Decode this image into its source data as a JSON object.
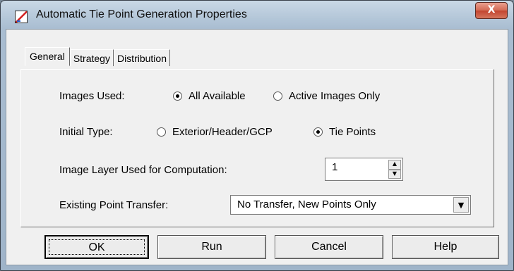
{
  "window": {
    "title": "Automatic Tie Point Generation Properties",
    "close_label": "X"
  },
  "tabs": [
    {
      "label": "General",
      "active": true
    },
    {
      "label": "Strategy",
      "active": false
    },
    {
      "label": "Distribution",
      "active": false
    }
  ],
  "general": {
    "images_used": {
      "label": "Images Used:",
      "options": [
        {
          "label": "All Available",
          "selected": true
        },
        {
          "label": "Active Images Only",
          "selected": false
        }
      ]
    },
    "initial_type": {
      "label": "Initial Type:",
      "options": [
        {
          "label": "Exterior/Header/GCP",
          "selected": false
        },
        {
          "label": "Tie Points",
          "selected": true
        }
      ]
    },
    "image_layer": {
      "label": "Image Layer Used for Computation:",
      "value": "1"
    },
    "point_transfer": {
      "label": "Existing Point Transfer:",
      "value": "No Transfer, New Points Only"
    }
  },
  "buttons": {
    "ok": "OK",
    "run": "Run",
    "cancel": "Cancel",
    "help": "Help"
  },
  "colors": {
    "dialog_bg": "#f0f0f0",
    "close_button": "#c24530",
    "frame": "#a9bdd1"
  }
}
